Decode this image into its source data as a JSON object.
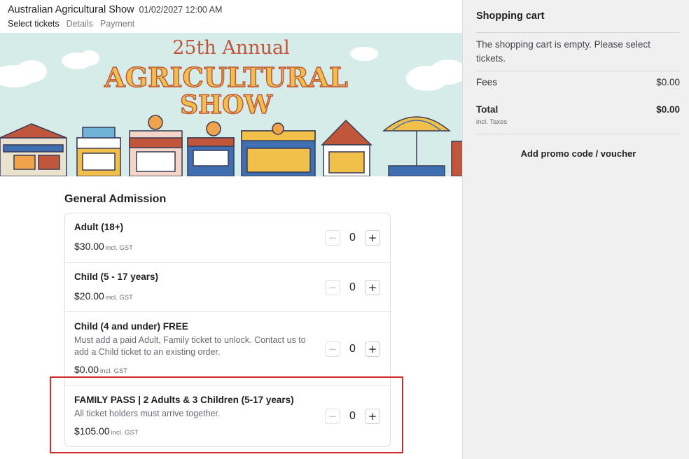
{
  "event": {
    "title": "Australian Agricultural Show",
    "datetime": "01/02/2027 12:00 AM",
    "steps": [
      {
        "label": "Select tickets",
        "active": true
      },
      {
        "label": "Details",
        "active": false
      },
      {
        "label": "Payment",
        "active": false
      }
    ]
  },
  "banner": {
    "line1": "25th Annual",
    "line2": "AGRICULTURAL",
    "line3": "SHOW",
    "colors": {
      "sky": "#d6ece9",
      "title_red": "#c0573b",
      "title_yellow": "#f0c04a",
      "outline": "#3a3a55"
    }
  },
  "section": {
    "title": "General Admission"
  },
  "tickets": [
    {
      "name": "Adult (18+)",
      "description": "",
      "price": "$30.00",
      "price_suffix": "incl. GST",
      "quantity": "0",
      "minus": "−",
      "plus": "+"
    },
    {
      "name": "Child (5 - 17 years)",
      "description": "",
      "price": "$20.00",
      "price_suffix": "incl. GST",
      "quantity": "0",
      "minus": "−",
      "plus": "+"
    },
    {
      "name": "Child (4 and under) FREE",
      "description": "Must add a paid Adult, Family ticket to unlock. Contact us to add a Child ticket to an existing order.",
      "price": "$0.00",
      "price_suffix": "incl. GST",
      "quantity": "0",
      "minus": "−",
      "plus": "+"
    },
    {
      "name": "FAMILY PASS | 2 Adults & 3 Children (5-17 years)",
      "description": "All ticket holders must arrive together.",
      "price": "$105.00",
      "price_suffix": "incl. GST",
      "quantity": "0",
      "minus": "−",
      "plus": "+"
    }
  ],
  "cart": {
    "title": "Shopping cart",
    "empty_message": "The shopping cart is empty. Please select tickets.",
    "fees_label": "Fees",
    "fees_value": "$0.00",
    "total_label": "Total",
    "total_value": "$0.00",
    "tax_note": "incl. Taxes",
    "promo_label": "Add promo code / voucher"
  },
  "colors": {
    "highlight": "#d42a2a",
    "sidebar_bg": "#f0f0f1",
    "border": "#dedee3"
  }
}
